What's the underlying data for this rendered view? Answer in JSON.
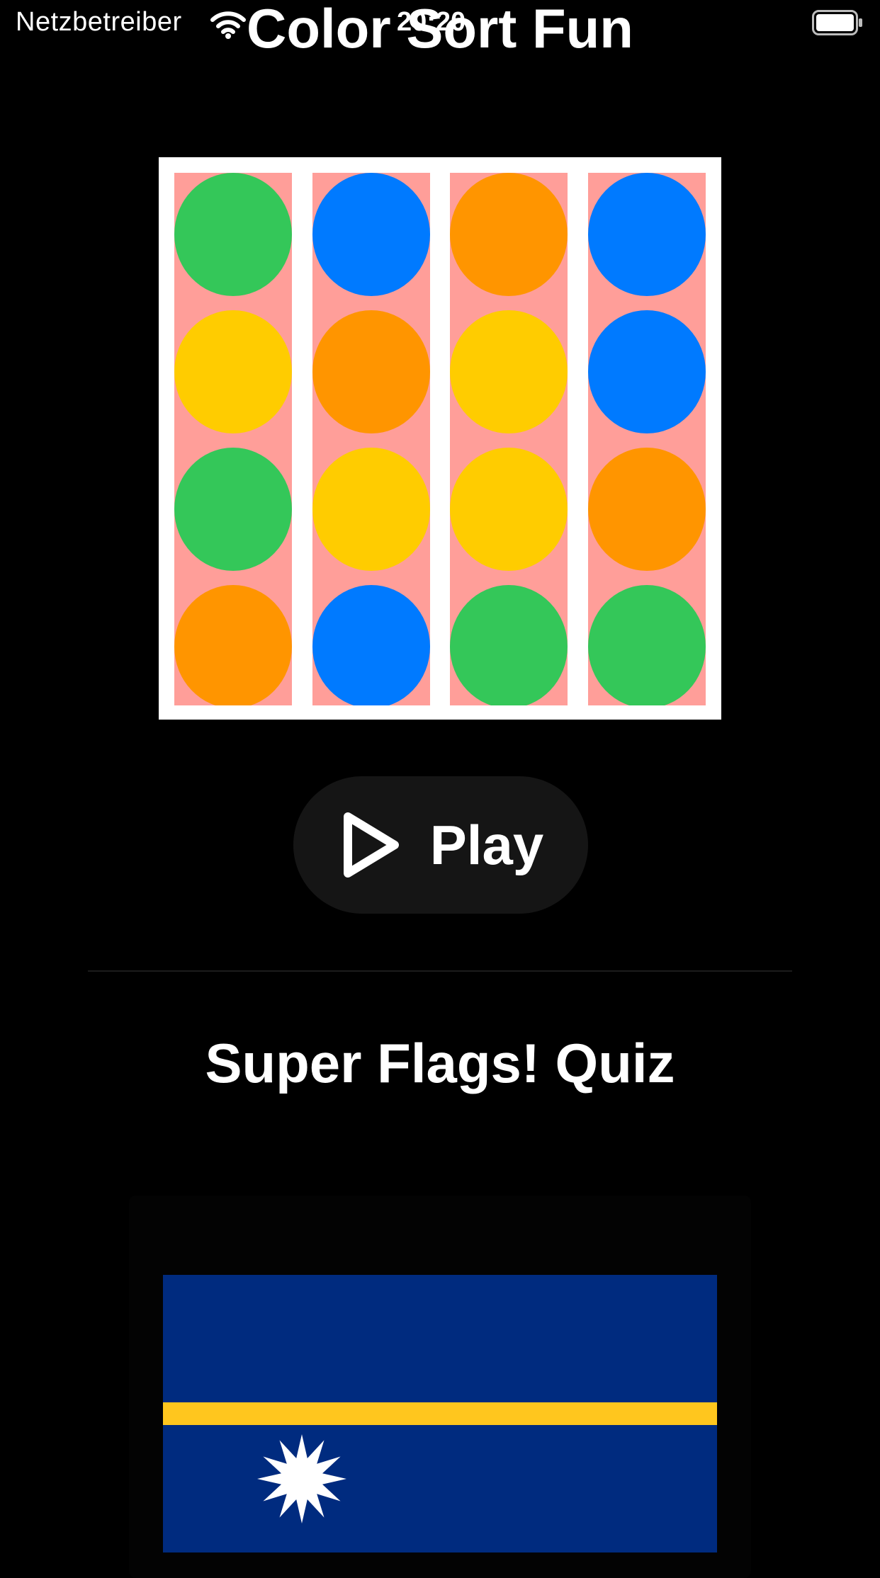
{
  "status_bar": {
    "carrier": "Netzbetreiber",
    "time": "20:20",
    "wifi_icon": "wifi-icon",
    "battery_icon": "battery-icon"
  },
  "app": {
    "title": "Color Sort Fun"
  },
  "puzzle": {
    "colors": {
      "green": "#34c759",
      "blue": "#007aff",
      "orange": "#ff9500",
      "yellow": "#ffcc00",
      "tube_background": "#ff9e99",
      "frame": "#ffffff"
    },
    "tubes": [
      [
        "green",
        "yellow",
        "green",
        "orange"
      ],
      [
        "blue",
        "orange",
        "yellow",
        "blue"
      ],
      [
        "orange",
        "yellow",
        "yellow",
        "green"
      ],
      [
        "blue",
        "blue",
        "orange",
        "green"
      ]
    ]
  },
  "play_button": {
    "label": "Play",
    "icon": "play-icon"
  },
  "quiz": {
    "title": "Super Flags! Quiz",
    "flag": {
      "name": "Nauru",
      "colors": {
        "field": "#002b7f",
        "stripe": "#ffc61e",
        "star": "#ffffff"
      }
    }
  }
}
